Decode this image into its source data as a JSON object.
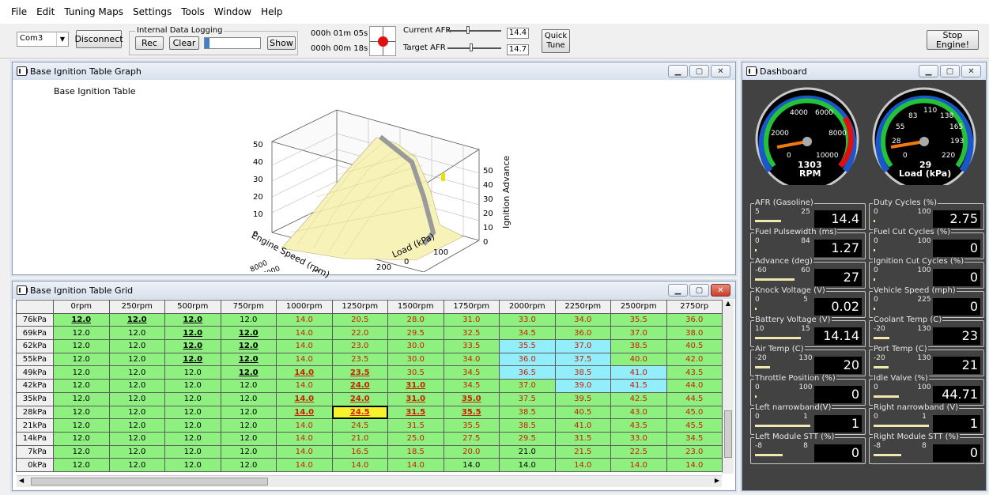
{
  "menu": [
    "File",
    "Edit",
    "Tuning Maps",
    "Settings",
    "Tools",
    "Window",
    "Help"
  ],
  "toolbar": {
    "port": "Com3",
    "disconnect": "Disconnect",
    "logging_label": "Internal Data Logging",
    "rec": "Rec",
    "clear": "Clear",
    "show": "Show",
    "time1": "000h 01m 05s",
    "time2": "000h 00m 18s",
    "current_afr_label": "Current AFR",
    "target_afr_label": "Target AFR",
    "current_afr": "14.4",
    "target_afr": "14.7",
    "quick_tune": "Quick Tune",
    "stop_engine": "Stop Engine!"
  },
  "graph_window": {
    "title": "Base Ignition Table Graph",
    "chart_title": "Base Ignition Table",
    "z_label": "Ignition Advance",
    "x_label": "Engine Speed (rpm)",
    "y_label": "Load (kPa)",
    "z_ticks": [
      "0",
      "10",
      "20",
      "30",
      "40",
      "50"
    ],
    "rpm_ticks": [
      "8000",
      "7000",
      "6000",
      "5000",
      "4000",
      "3000",
      "2000",
      "1000",
      "0"
    ],
    "load_ticks": [
      "0",
      "100",
      "200"
    ]
  },
  "grid_window": {
    "title": "Base Ignition Table Grid",
    "columns": [
      "0rpm",
      "250rpm",
      "500rpm",
      "750rpm",
      "1000rpm",
      "1250rpm",
      "1500rpm",
      "1750rpm",
      "2000rpm",
      "2250rpm",
      "2500rpm",
      "2750rp"
    ],
    "rows": [
      {
        "label": "76kPa",
        "cells": [
          "12.0",
          "12.0",
          "12.0",
          "12.0",
          "14.0",
          "20.5",
          "28.0",
          "31.0",
          "33.0",
          "34.0",
          "35.5",
          "36.0"
        ]
      },
      {
        "label": "69kPa",
        "cells": [
          "12.0",
          "12.0",
          "12.0",
          "12.0",
          "14.0",
          "22.0",
          "29.5",
          "32.5",
          "34.5",
          "36.0",
          "37.0",
          "38.0"
        ]
      },
      {
        "label": "62kPa",
        "cells": [
          "12.0",
          "12.0",
          "12.0",
          "12.0",
          "14.0",
          "23.0",
          "30.0",
          "33.5",
          "35.5",
          "37.0",
          "38.5",
          "40.5"
        ]
      },
      {
        "label": "55kPa",
        "cells": [
          "12.0",
          "12.0",
          "12.0",
          "12.0",
          "14.0",
          "23.5",
          "30.0",
          "34.0",
          "36.0",
          "37.5",
          "40.0",
          "42.0"
        ]
      },
      {
        "label": "49kPa",
        "cells": [
          "12.0",
          "12.0",
          "12.0",
          "12.0",
          "14.0",
          "23.5",
          "30.5",
          "34.5",
          "36.5",
          "38.5",
          "41.0",
          "43.5"
        ]
      },
      {
        "label": "42kPa",
        "cells": [
          "12.0",
          "12.0",
          "12.0",
          "12.0",
          "14.0",
          "24.0",
          "31.0",
          "34.5",
          "37.0",
          "39.0",
          "41.5",
          "44.0"
        ]
      },
      {
        "label": "35kPa",
        "cells": [
          "12.0",
          "12.0",
          "12.0",
          "12.0",
          "14.0",
          "24.0",
          "31.0",
          "35.0",
          "37.5",
          "39.5",
          "42.5",
          "44.5"
        ]
      },
      {
        "label": "28kPa",
        "cells": [
          "12.0",
          "12.0",
          "12.0",
          "12.0",
          "14.0",
          "24.5",
          "31.5",
          "35.5",
          "38.5",
          "40.5",
          "43.0",
          "45.0"
        ]
      },
      {
        "label": "21kPa",
        "cells": [
          "12.0",
          "12.0",
          "12.0",
          "12.0",
          "14.0",
          "24.5",
          "31.5",
          "35.5",
          "38.5",
          "41.0",
          "43.5",
          "45.5"
        ]
      },
      {
        "label": "14kPa",
        "cells": [
          "12.0",
          "12.0",
          "12.0",
          "12.0",
          "14.0",
          "21.0",
          "25.0",
          "27.5",
          "29.5",
          "31.5",
          "33.0",
          "34.5"
        ]
      },
      {
        "label": "7kPa",
        "cells": [
          "12.0",
          "12.0",
          "12.0",
          "12.0",
          "14.0",
          "16.5",
          "18.5",
          "20.0",
          "21.0",
          "21.5",
          "22.5",
          "23.0"
        ]
      },
      {
        "label": "0kPa",
        "cells": [
          "12.0",
          "12.0",
          "12.0",
          "12.0",
          "14.0",
          "14.0",
          "14.0",
          "14.0",
          "14.0",
          "14.0",
          "14.0",
          "14.0"
        ]
      }
    ]
  },
  "dashboard": {
    "title": "Dashboard",
    "rpm_gauge": {
      "label": "RPM",
      "value": "1303",
      "ticks": [
        "0",
        "2000",
        "4000",
        "6000",
        "8000",
        "10000"
      ]
    },
    "load_gauge": {
      "label": "Load (kPa)",
      "value": "29",
      "ticks": [
        "0",
        "28",
        "55",
        "83",
        "110",
        "138",
        "165",
        "193",
        "220"
      ]
    },
    "panels": [
      {
        "label": "AFR (Gasoline)",
        "min": "5",
        "max": "25",
        "value": "14.4",
        "fill": 0.47
      },
      {
        "label": "Duty Cycles (%)",
        "min": "0",
        "max": "100",
        "value": "2.75",
        "fill": 0.03
      },
      {
        "label": "Fuel Pulsewidth (ms)",
        "min": "0",
        "max": "84",
        "value": "1.27",
        "fill": 0.02
      },
      {
        "label": "Fuel Cut Cycles (%)",
        "min": "0",
        "max": "100",
        "value": "0",
        "fill": 0
      },
      {
        "label": "Advance (deg)",
        "min": "-60",
        "max": "60",
        "value": "27",
        "fill": 0.72
      },
      {
        "label": "Ignition Cut Cycles (%)",
        "min": "0",
        "max": "100",
        "value": "0",
        "fill": 0
      },
      {
        "label": "Knock Voltage (V)",
        "min": "0",
        "max": "5",
        "value": "0.02",
        "fill": 0
      },
      {
        "label": "Vehicle Speed (mph)",
        "min": "0",
        "max": "225",
        "value": "0",
        "fill": 0
      },
      {
        "label": "Battery Voltage (V)",
        "min": "10",
        "max": "15",
        "value": "14.14",
        "fill": 0.83
      },
      {
        "label": "Coolant Temp (C)",
        "min": "-20",
        "max": "130",
        "value": "23",
        "fill": 0.29
      },
      {
        "label": "Air Temp (C)",
        "min": "-20",
        "max": "130",
        "value": "20",
        "fill": 0.27
      },
      {
        "label": "Port Temp (C)",
        "min": "-20",
        "max": "130",
        "value": "21",
        "fill": 0.27
      },
      {
        "label": "Throttle Position (%)",
        "min": "0",
        "max": "100",
        "value": "0",
        "fill": 0
      },
      {
        "label": "Idle Valve (%)",
        "min": "0",
        "max": "100",
        "value": "44.71",
        "fill": 0.45
      },
      {
        "label": "Left narrowband(V)",
        "min": "0",
        "max": "1",
        "value": "1",
        "fill": 1
      },
      {
        "label": "Right narrowband (V)",
        "min": "0",
        "max": "1",
        "value": "1",
        "fill": 1
      },
      {
        "label": "Left Module STT (%)",
        "min": "-8",
        "max": "8",
        "value": "0",
        "fill": 0.5
      },
      {
        "label": "Right Module STT (%)",
        "min": "-8",
        "max": "8",
        "value": "0",
        "fill": 0.5
      }
    ]
  }
}
